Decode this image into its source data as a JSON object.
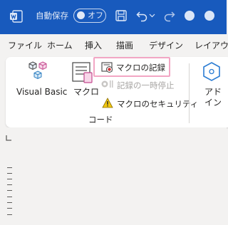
{
  "titlebar": {
    "autosave_label": "自動保存",
    "autosave_toggle_text": "オフ",
    "brand_color": "#185abd"
  },
  "tabs": [
    "ファイル",
    "ホーム",
    "挿入",
    "描画",
    "デザイン",
    "レイアウト"
  ],
  "ribbon": {
    "visual_basic_label": "Visual Basic",
    "macro_label": "マクロ",
    "record_macro_label": "マクロの記録",
    "pause_recording_label": "記録の一時停止",
    "macro_security_label": "マクロのセキュリティ",
    "group_label": "コード",
    "addin_label_line1": "アド",
    "addin_label_line2": "イン"
  },
  "icons": {
    "app": "word-doc-icon",
    "save": "save-icon",
    "undo": "undo-icon",
    "undo_dropdown": "chevron-down-icon",
    "redo": "redo-icon",
    "circle1": "circle-icon",
    "circle2": "circle-icon",
    "visual_basic": "visual-basic-cubes-icon",
    "macro": "macro-list-icon",
    "record": "record-macro-icon",
    "pause": "pause-record-icon",
    "security": "warning-icon",
    "addin": "hexagon-icon"
  }
}
